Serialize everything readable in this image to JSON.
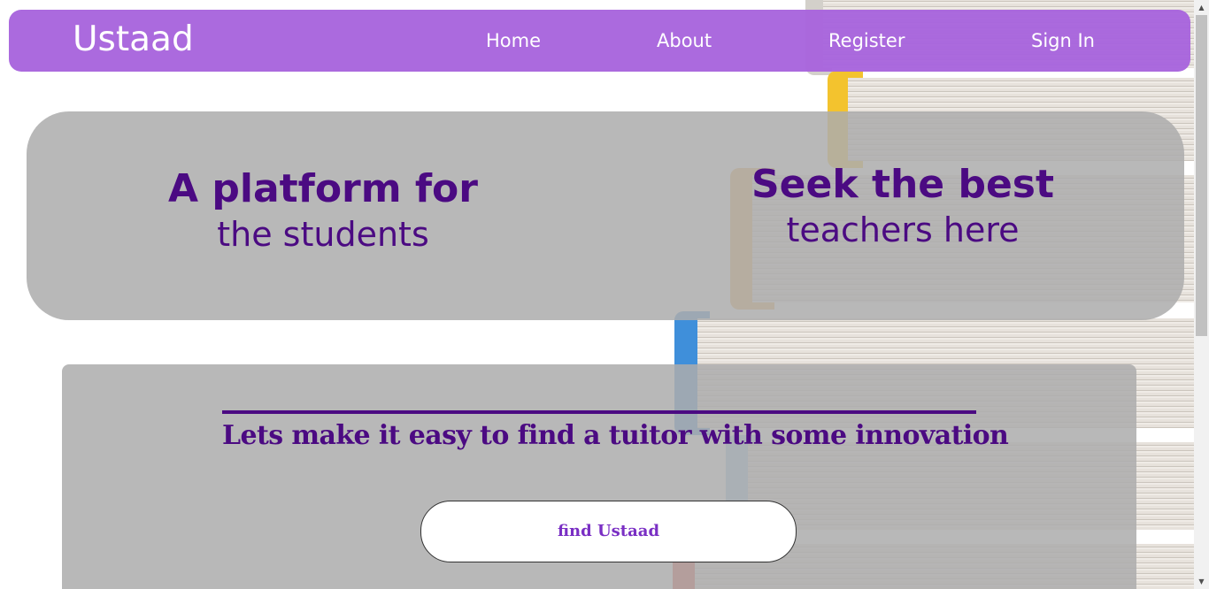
{
  "nav": {
    "brand": "Ustaad",
    "links": [
      "Home",
      "About",
      "Register",
      "Sign In"
    ]
  },
  "hero": {
    "left": {
      "line1": "A platform for",
      "line2": "the students"
    },
    "right": {
      "line1": "Seek the best",
      "line2": "teachers here"
    }
  },
  "tagline": "Lets make it easy to find a tuitor with some innovation",
  "cta": {
    "label": "find Ustaad"
  },
  "scrollbar": {
    "up_icon": "up-arrow-icon",
    "down_icon": "down-arrow-icon",
    "up_glyph": "▲",
    "down_glyph": "▼"
  },
  "colors": {
    "nav_bg": "#a864dd",
    "accent_text": "#4b0a82",
    "cta_text": "#7a2fc4",
    "panel_bg": "#acacac"
  }
}
